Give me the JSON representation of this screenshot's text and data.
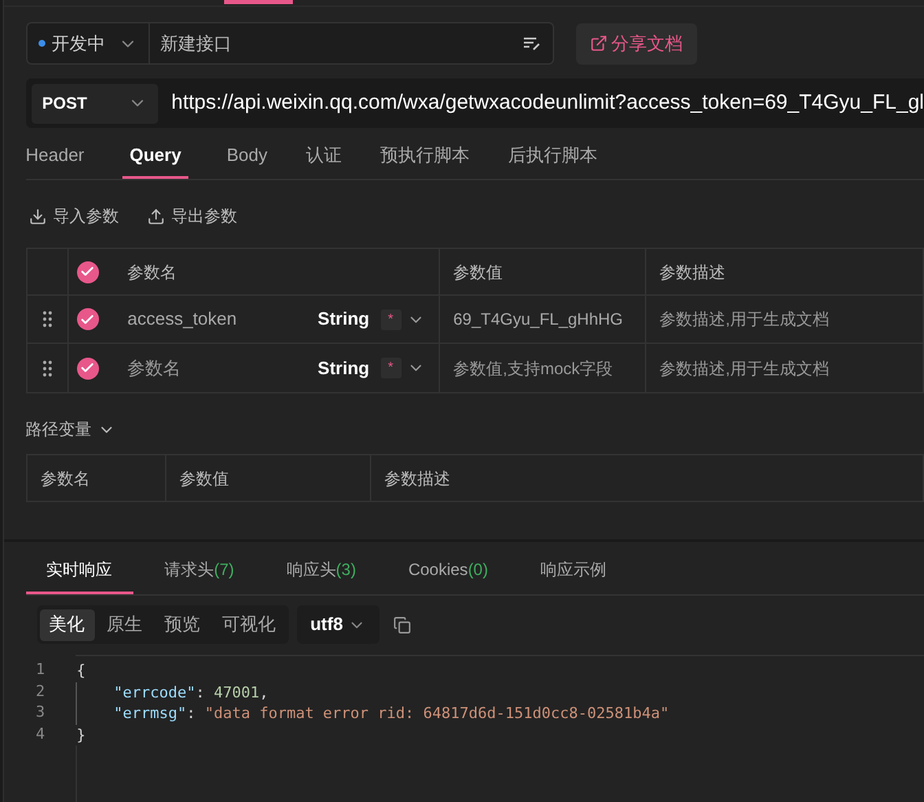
{
  "request": {
    "status": "开发中",
    "name_placeholder": "新建接口",
    "share_button": "分享文档",
    "method": "POST",
    "url": "https://api.weixin.qq.com/wxa/getwxacodeunlimit?access_token=69_T4Gyu_FL_gl"
  },
  "tabs": [
    {
      "label": "Header",
      "selected": false
    },
    {
      "label": "Query",
      "selected": true
    },
    {
      "label": "Body",
      "selected": false
    },
    {
      "label": "认证",
      "selected": false
    },
    {
      "label": "预执行脚本",
      "selected": false
    },
    {
      "label": "后执行脚本",
      "selected": false
    }
  ],
  "param_actions": [
    "导入参数",
    "导出参数"
  ],
  "params_table": {
    "columns": [
      "参数名",
      "参数值",
      "参数描述"
    ],
    "all_checked": true,
    "rows": [
      {
        "checked": true,
        "name": "access_token",
        "name_is_placeholder": false,
        "type": "String",
        "required": "*",
        "value": "69_T4Gyu_FL_gHhHG",
        "value_is_placeholder": false,
        "description": "参数描述,用于生成文档"
      },
      {
        "checked": true,
        "name": "参数名",
        "name_is_placeholder": true,
        "type": "String",
        "required": "*",
        "value": "参数值,支持mock字段",
        "value_is_placeholder": true,
        "description": "参数描述,用于生成文档"
      }
    ]
  },
  "path_variables": {
    "title": "路径变量",
    "expanded": true,
    "columns": [
      "参数名",
      "参数值",
      "参数描述"
    ]
  },
  "response_tabs": [
    {
      "label": "实时响应",
      "selected": true
    },
    {
      "label": "请求头",
      "count": "(7)",
      "selected": false
    },
    {
      "label": "响应头",
      "count": "(3)",
      "selected": false
    },
    {
      "label": "Cookies",
      "count": "(0)",
      "selected": false
    },
    {
      "label": "响应示例",
      "selected": false
    }
  ],
  "view_modes": [
    {
      "label": "美化",
      "selected": true
    },
    {
      "label": "原生",
      "selected": false
    },
    {
      "label": "预览",
      "selected": false
    },
    {
      "label": "可视化",
      "selected": false
    }
  ],
  "encoding": "utf8",
  "code": [
    {
      "number": "1",
      "indented": false,
      "tokens": [
        {
          "kind": "punct",
          "text": "{"
        }
      ]
    },
    {
      "number": "2",
      "indented": true,
      "tokens": [
        {
          "kind": "key",
          "text": "\"errcode\""
        },
        {
          "kind": "punct",
          "text": ": "
        },
        {
          "kind": "number",
          "text": "47001"
        },
        {
          "kind": "punct",
          "text": ","
        }
      ]
    },
    {
      "number": "3",
      "indented": true,
      "tokens": [
        {
          "kind": "key",
          "text": "\"errmsg\""
        },
        {
          "kind": "punct",
          "text": ": "
        },
        {
          "kind": "string",
          "text": "\"data format error rid: 64817d6d-151d0cc8-02581b4a\""
        }
      ]
    },
    {
      "number": "4",
      "indented": false,
      "tokens": [
        {
          "kind": "punct",
          "text": "}"
        }
      ]
    }
  ]
}
